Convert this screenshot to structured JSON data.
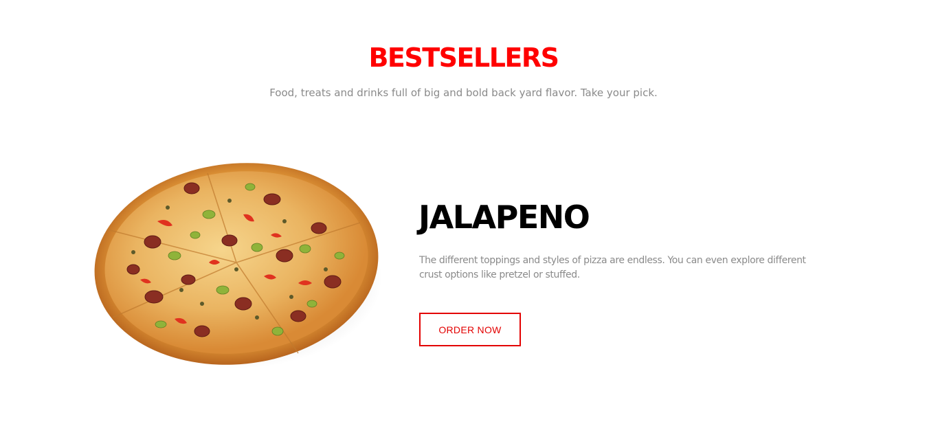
{
  "section": {
    "title": "BESTSELLERS",
    "subtitle": "Food, treats and drinks full of big and bold back yard flavor. Take your pick."
  },
  "product": {
    "name": "JALAPENO",
    "description": "The different toppings and styles of pizza are endless. You can even explore different crust options like pretzel or stuffed.",
    "button_label": "ORDER NOW",
    "image_icon": "pizza-image"
  },
  "colors": {
    "accent": "#ff0000",
    "button_border": "#e30000",
    "muted_text": "#8a8a8a",
    "heading_text": "#000000",
    "background": "#ffffff"
  }
}
